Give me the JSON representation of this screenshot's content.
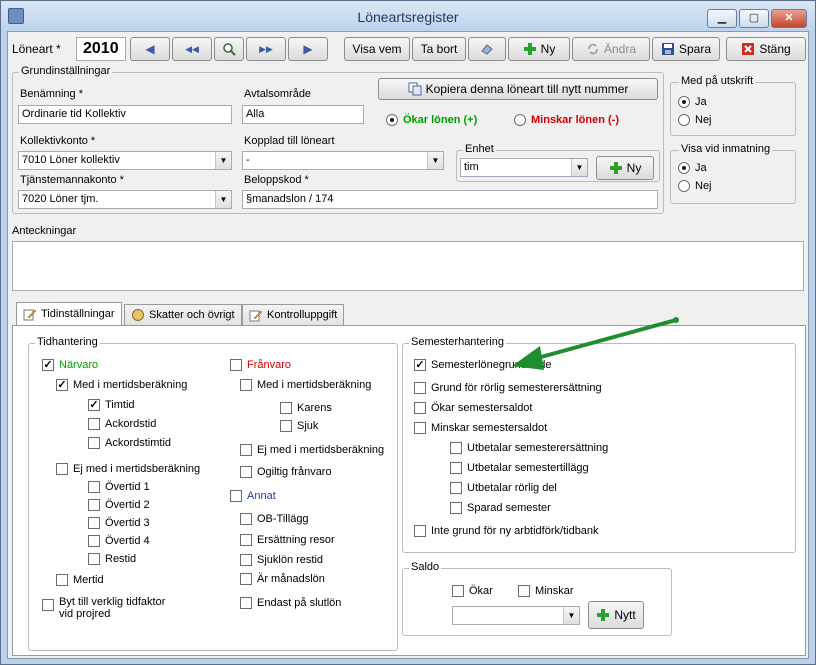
{
  "window": {
    "title": "Löneartsregister",
    "controls": {
      "minimize": "▁",
      "maximize": "▢",
      "close": "✕"
    }
  },
  "toolbar": {
    "loneart_label": "Löneart *",
    "loneart_value": "2010",
    "nav_prev": "◀",
    "nav_first": "◀◀",
    "nav_next_fast": "▶▶",
    "nav_next": "▶",
    "visa_vem": "Visa vem",
    "ta_bort": "Ta bort",
    "ny": "Ny",
    "andra": "Ändra",
    "spara": "Spara",
    "stang": "Stäng"
  },
  "grund": {
    "title": "Grundinställningar",
    "benamning_label": "Benämning *",
    "benamning_value": "Ordinarie tid Kollektiv",
    "avtalsomrade_label": "Avtalsområde",
    "avtalsomrade_value": "Alla",
    "kopiera_label": "Kopiera denna löneart till nytt nummer",
    "okar_label": "Ökar lönen (+)",
    "minskar_label": "Minskar lönen (-)",
    "kollektivkonto_label": "Kollektivkonto *",
    "kollektivkonto_value": "7010 Löner kollektiv",
    "kopplad_label": "Kopplad till löneart",
    "kopplad_value": "-",
    "enhet_title": "Enhet",
    "enhet_value": "tim",
    "enhet_ny": "Ny",
    "tjanstemannakonto_label": "Tjänstemannakonto *",
    "tjanstemannakonto_value": "7020 Löner tjm.",
    "beloppskod_label": "Beloppskod *",
    "beloppskod_value": "§manadslon / 174"
  },
  "utskrift": {
    "title": "Med på utskrift",
    "ja": "Ja",
    "nej": "Nej"
  },
  "inmatning": {
    "title": "Visa vid inmatning",
    "ja": "Ja",
    "nej": "Nej"
  },
  "anteckningar": {
    "label": "Anteckningar",
    "value": ""
  },
  "tabs": {
    "t1": "Tidinställningar",
    "t2": "Skatter och övrigt",
    "t3": "Kontrolluppgift"
  },
  "tidhantering": {
    "title": "Tidhantering",
    "narvaro": "Närvaro",
    "med_mertid": "Med i mertidsberäkning",
    "timtid": "Timtid",
    "ackordstid": "Ackordstid",
    "ackordstimtid": "Ackordstimtid",
    "ej_med_mertid": "Ej med i mertidsberäkning",
    "overtid1": "Övertid 1",
    "overtid2": "Övertid 2",
    "overtid3": "Övertid 3",
    "overtid4": "Övertid 4",
    "restid": "Restid",
    "mertid": "Mertid",
    "byt": "Byt till verklig tidfaktor",
    "byt2": "vid projred",
    "franvaro": "Frånvaro",
    "fr_med_mertid": "Med i mertidsberäkning",
    "karens": "Karens",
    "sjuk": "Sjuk",
    "fr_ej_med_mertid": "Ej med i mertidsberäkning",
    "ogiltig": "Ogiltig frånvaro",
    "annat": "Annat",
    "ob": "OB-Tillägg",
    "ersattning": "Ersättning resor",
    "sjuklon": "Sjuklön restid",
    "manadslon": "Är månadslön",
    "endast": "Endast på slutlön"
  },
  "semester": {
    "title": "Semesterhantering",
    "grundande": "Semesterlönegrundande",
    "rorlig": "Grund för rörlig semesterersättning",
    "okar_saldo": "Ökar semestersaldot",
    "minskar_saldo": "Minskar semestersaldot",
    "utb_ersattning": "Utbetalar semesterersättning",
    "utb_tillagg": "Utbetalar semestertillägg",
    "utb_rorlig": "Utbetalar rörlig del",
    "sparad": "Sparad semester",
    "inte_grund": "Inte grund för ny arbtidförk/tidbank"
  },
  "saldo": {
    "title": "Saldo",
    "okar": "Ökar",
    "minskar": "Minskar",
    "value": "",
    "nytt": "Nytt"
  },
  "colors": {
    "green_text": "#00a000",
    "red_text": "#d00000",
    "blue_text": "#1f3fa8",
    "arrow": "#1e8f2e"
  }
}
